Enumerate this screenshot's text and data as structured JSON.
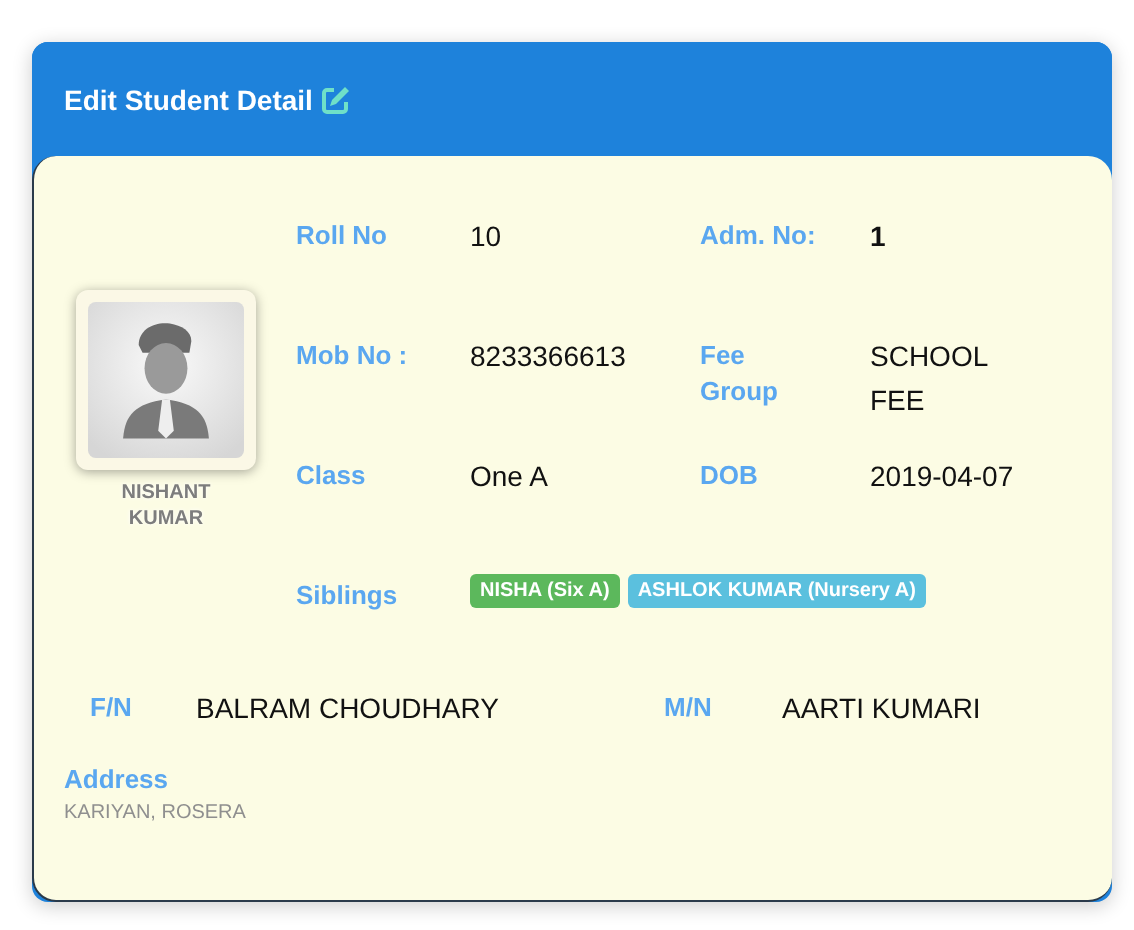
{
  "header": {
    "title": "Edit Student Detail"
  },
  "student": {
    "name": "NISHANT KUMAR"
  },
  "fields": [
    {
      "label": "Roll No",
      "value": "10",
      "bold": false
    },
    {
      "label": "Adm. No:",
      "value": "1",
      "bold": true
    },
    {
      "label": "Mob No :",
      "value": "8233366613",
      "bold": false
    },
    {
      "label": "Fee Group",
      "value": "SCHOOL FEE",
      "bold": false
    },
    {
      "label": "Class",
      "value": "One A",
      "bold": false
    },
    {
      "label": "DOB",
      "value": "2019-04-07",
      "bold": false
    }
  ],
  "siblings": {
    "label": "Siblings",
    "items": [
      {
        "text": "NISHA (Six A)",
        "color": "#5cb85c"
      },
      {
        "text": "ASHLOK KUMAR (Nursery A)",
        "color": "#5bc0de"
      }
    ]
  },
  "parents": [
    {
      "label": "F/N",
      "value": "BALRAM CHOUDHARY"
    },
    {
      "label": "M/N",
      "value": "AARTI KUMARI"
    }
  ],
  "address": {
    "label": "Address",
    "value": "KARIYAN, ROSERA"
  }
}
